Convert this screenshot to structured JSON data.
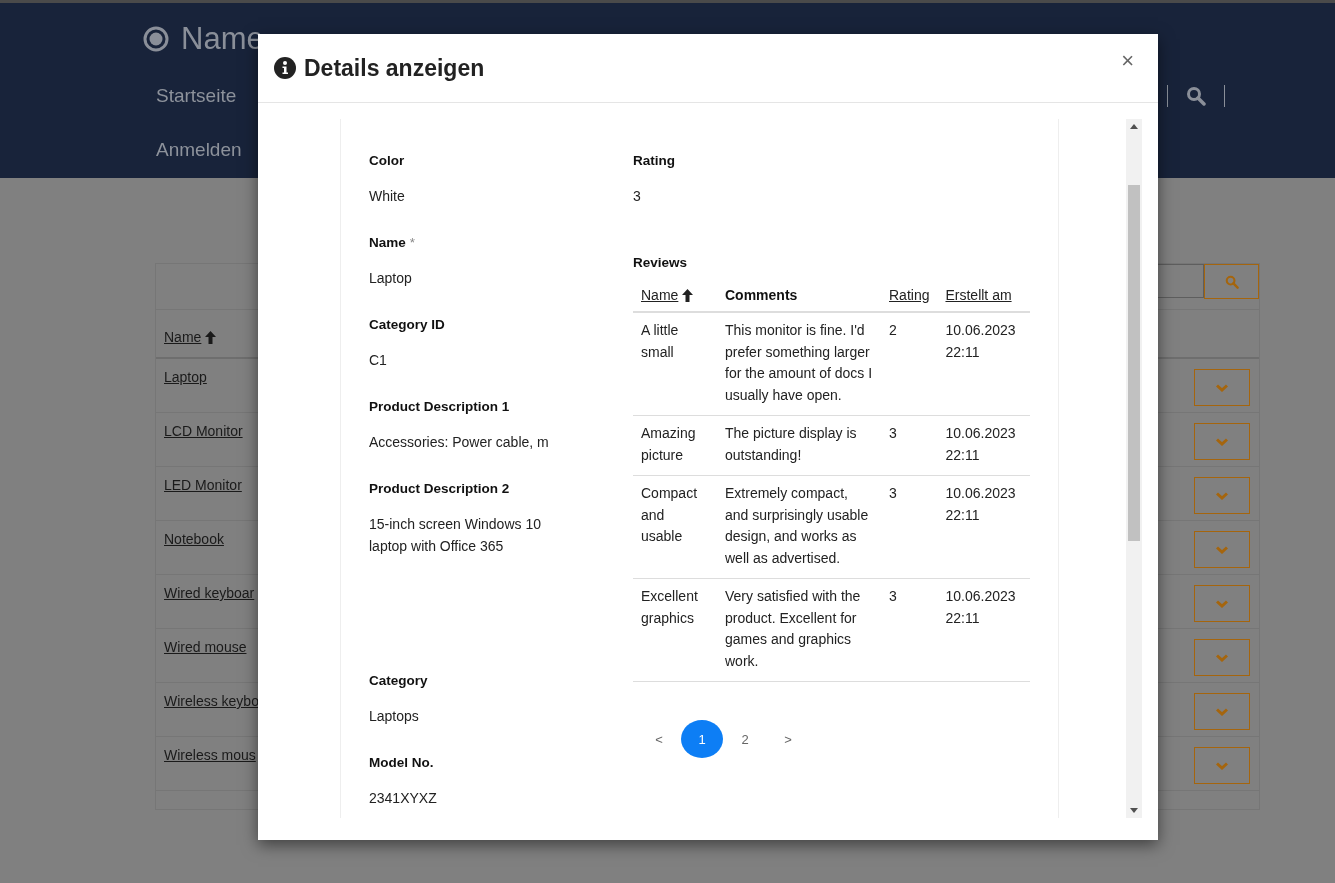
{
  "header": {
    "brand": "Name",
    "nav": [
      {
        "label": "Startseite"
      },
      {
        "label": "Anmelden"
      }
    ]
  },
  "product_list": {
    "columns": [
      {
        "label": "Name"
      }
    ],
    "rows": [
      {
        "name": "Laptop"
      },
      {
        "name": "LCD Monitor"
      },
      {
        "name": "LED Monitor"
      },
      {
        "name": "Notebook"
      },
      {
        "name": "Wired keyboar"
      },
      {
        "name": "Wired mouse"
      },
      {
        "name": "Wireless keybo"
      },
      {
        "name": "Wireless mous"
      }
    ]
  },
  "dialog": {
    "title": "Details anzeigen",
    "close": "×",
    "fields": [
      {
        "label": "Color",
        "value": "White"
      },
      {
        "label": "Name",
        "required_mark": "*",
        "value": "Laptop"
      },
      {
        "label": "Category ID",
        "value": "C1"
      },
      {
        "label": "Product Description 1",
        "value": "Accessories: Power cable, m"
      },
      {
        "label": "Product Description 2",
        "value": "15-inch screen Windows 10 laptop with Office 365"
      },
      {
        "label": "Category",
        "value": "Laptops"
      },
      {
        "label": "Model No.",
        "value": "2341XYXZ"
      }
    ],
    "rating": {
      "label": "Rating",
      "value": "3"
    },
    "reviews": {
      "label": "Reviews",
      "columns": [
        {
          "label": "Name",
          "sortable": true,
          "sorted": true
        },
        {
          "label": "Comments",
          "sortable": false,
          "sorted": false
        },
        {
          "label": "Rating",
          "sortable": true,
          "sorted": false
        },
        {
          "label": "Erstellt am",
          "sortable": true,
          "sorted": false
        }
      ],
      "rows": [
        {
          "name": "A little small",
          "comment": "This monitor is fine. I'd prefer something larger for the amount of docs I usually have open.",
          "rating": "2",
          "created": "10.06.2023 22:11"
        },
        {
          "name": "Amazing picture",
          "comment": "The picture display is outstanding!",
          "rating": "3",
          "created": "10.06.2023 22:11"
        },
        {
          "name": "Compact and usable",
          "comment": "Extremely compact, and surprisingly usable design, and works as well as advertised.",
          "rating": "3",
          "created": "10.06.2023 22:11"
        },
        {
          "name": "Excellent graphics",
          "comment": "Very satisfied with the product. Excellent for games and graphics work.",
          "rating": "3",
          "created": "10.06.2023 22:11"
        }
      ]
    },
    "pagination": {
      "prev": "<",
      "next": ">",
      "pages": [
        {
          "label": "1",
          "selected": true
        },
        {
          "label": "2",
          "selected": false
        }
      ]
    }
  }
}
